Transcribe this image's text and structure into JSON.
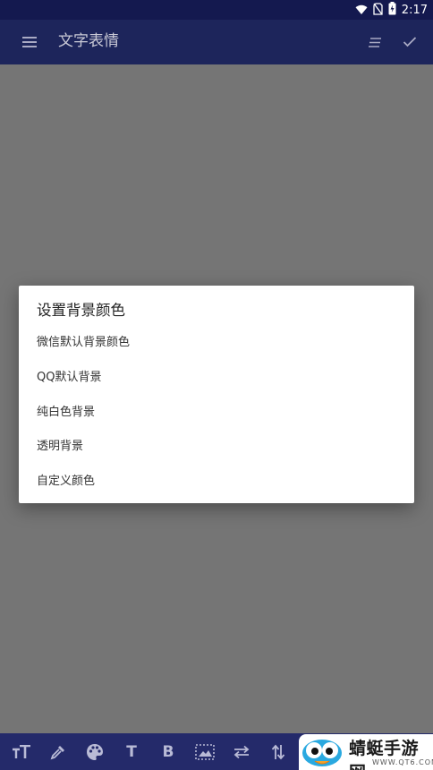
{
  "status_bar": {
    "time": "2:17",
    "icons": [
      "wifi-icon",
      "no-sim-icon",
      "battery-charging-icon"
    ]
  },
  "app_bar": {
    "menu_icon": "menu-icon",
    "title": "文字表情",
    "actions": [
      "sort-lines-icon",
      "check-icon"
    ]
  },
  "dialog": {
    "title": "设置背景颜色",
    "options": [
      "微信默认背景颜色",
      "QQ默认背景",
      "纯白色背景",
      "透明背景",
      "自定义颜色"
    ]
  },
  "toolbar": {
    "items": [
      "text-size-icon",
      "color-picker-icon",
      "palette-icon",
      "text-icon",
      "bold-icon",
      "image-select-icon",
      "swap-horizontal-icon",
      "swap-vertical-icon"
    ],
    "text_label": "T",
    "bold_label": "B"
  },
  "watermark": {
    "brand": "蜻蜓手游网",
    "url": "WWW.QT6.COM"
  },
  "colors": {
    "status_bar": "#14194f",
    "app_bar": "#1d255b",
    "toolbar": "#242a6a",
    "scrim": "#757575",
    "dialog": "#ffffff"
  }
}
